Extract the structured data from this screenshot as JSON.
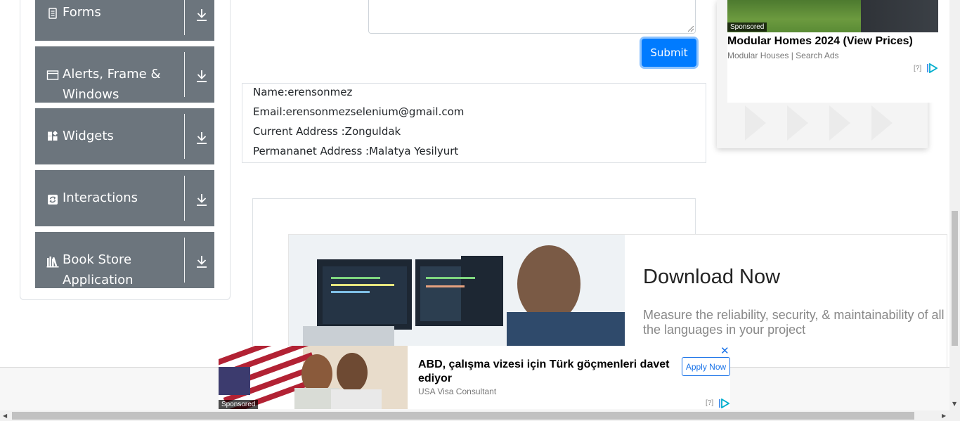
{
  "sidebar": {
    "items": [
      {
        "label": "Forms",
        "icon": "document-icon"
      },
      {
        "label": "Alerts, Frame & Windows",
        "icon": "window-icon"
      },
      {
        "label": "Widgets",
        "icon": "widgets-icon"
      },
      {
        "label": "Interactions",
        "icon": "interactions-icon"
      },
      {
        "label": "Book Store Application",
        "icon": "books-icon"
      }
    ]
  },
  "form": {
    "submit_label": "Submit"
  },
  "output": {
    "name": "Name:erensonmez",
    "email": "Email:erensonmezselenium@gmail.com",
    "current_address": "Current Address :Zonguldak",
    "permanent_address": "Permananet Address :Malatya Yesilyurt"
  },
  "ad_right": {
    "sponsored": "Sponsored",
    "title": "Modular Homes 2024 (View Prices)",
    "source": "Modular Houses | Search Ads",
    "adchoice": "[?]"
  },
  "ad_middle": {
    "title": "Download Now",
    "description": "Measure the reliability, security, & maintainability of all the languages in your project"
  },
  "ad_bottom": {
    "sponsored": "Sponsored",
    "title": "ABD, çalışma vizesi için Türk göçmenleri davet ediyor",
    "source": "USA Visa Consultant",
    "apply_label": "Apply Now",
    "close": "✕",
    "adchoice": "[?]"
  },
  "colors": {
    "menu_bg": "#6c757d",
    "primary": "#007bff",
    "adchoice_blue": "#1a73e8"
  }
}
